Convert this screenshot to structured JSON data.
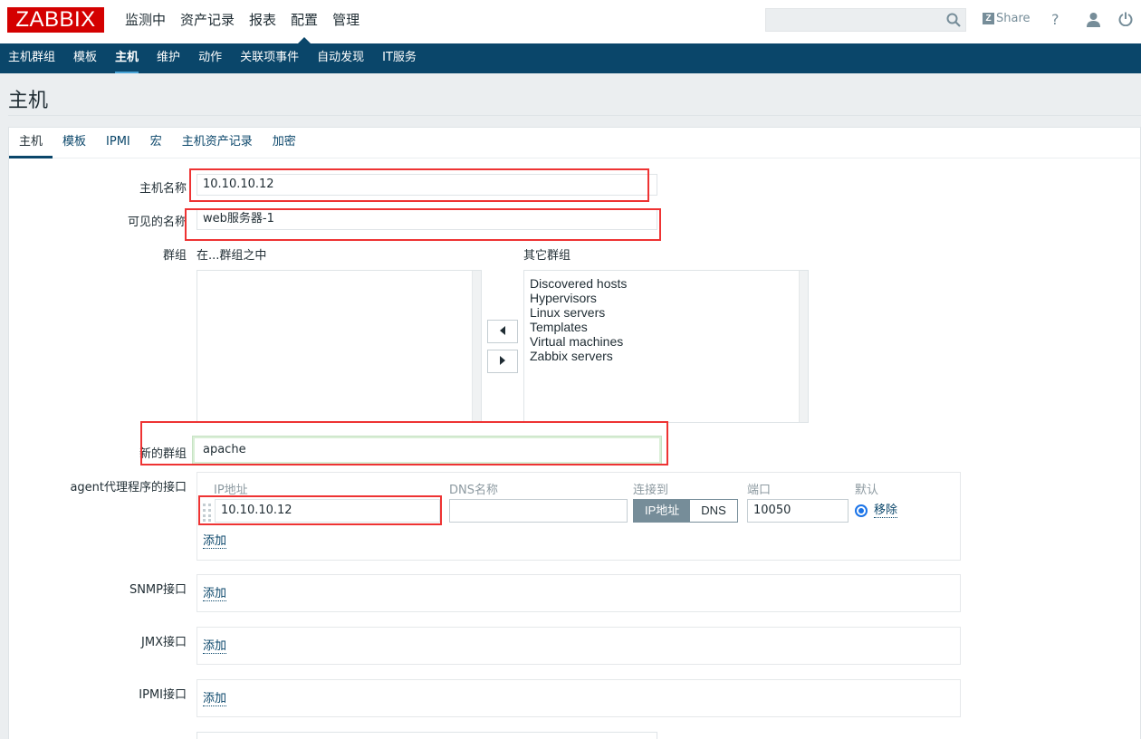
{
  "logo": "ZABBIX",
  "main_nav": [
    "监测中",
    "资产记录",
    "报表",
    "配置",
    "管理"
  ],
  "search": {
    "placeholder": ""
  },
  "share_label": "Share",
  "help_label": "?",
  "sub_nav": [
    "主机群组",
    "模板",
    "主机",
    "维护",
    "动作",
    "关联项事件",
    "自动发现",
    "IT服务"
  ],
  "page_title": "主机",
  "tabs": [
    "主机",
    "模板",
    "IPMI",
    "宏",
    "主机资产记录",
    "加密"
  ],
  "form": {
    "host_name_label": "主机名称",
    "host_name_value": "10.10.10.12",
    "visible_name_label": "可见的名称",
    "visible_name_value": "web服务器-1",
    "groups_label": "群组",
    "in_groups_label": "在...群组之中",
    "other_groups_label": "其它群组",
    "other_groups": [
      "Discovered hosts",
      "Hypervisors",
      "Linux servers",
      "Templates",
      "Virtual machines",
      "Zabbix servers"
    ],
    "new_group_label": "新的群组",
    "new_group_value": "apache",
    "agent_label": "agent代理程序的接口",
    "agent_headers": {
      "ip": "IP地址",
      "dns": "DNS名称",
      "connect": "连接到",
      "port": "端口",
      "default": "默认"
    },
    "agent_ip_value": "10.10.10.12",
    "agent_dns_value": "",
    "connect_ip": "IP地址",
    "connect_dns": "DNS",
    "agent_port_value": "10050",
    "remove_label": "移除",
    "add_label": "添加",
    "snmp_label": "SNMP接口",
    "jmx_label": "JMX接口",
    "ipmi_label": "IPMI接口"
  },
  "colors": {
    "brand_red": "#d40000",
    "nav_blue": "#0a466a",
    "annotation_red": "#e33333"
  },
  "icons": [
    "search-icon",
    "share-z-icon",
    "help-icon",
    "user-icon",
    "logout-icon",
    "arrow-left-icon",
    "arrow-right-icon",
    "drag-handle-icon"
  ]
}
